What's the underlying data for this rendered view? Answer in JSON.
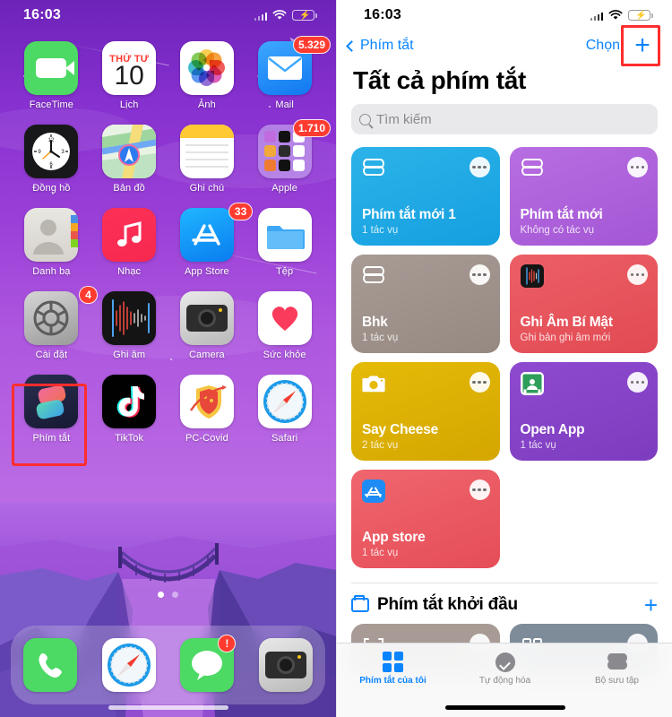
{
  "home": {
    "status": {
      "time": "16:03",
      "wifi": "wifi-icon",
      "battery": "battery-charging-icon",
      "signal": "cellular-signal-icon"
    },
    "apps": [
      {
        "label": "FaceTime",
        "icon": "facetime-icon",
        "badge": null
      },
      {
        "label": "Lịch",
        "icon": "calendar-icon",
        "badge": null,
        "cal_day": "THỨ TƯ",
        "cal_date": "10"
      },
      {
        "label": "Ảnh",
        "icon": "photos-icon",
        "badge": null
      },
      {
        "label": "Mail",
        "icon": "mail-icon",
        "badge": "5.329"
      },
      {
        "label": "Đồng hồ",
        "icon": "clock-icon",
        "badge": null
      },
      {
        "label": "Bản đồ",
        "icon": "maps-icon",
        "badge": null
      },
      {
        "label": "Ghi chú",
        "icon": "notes-icon",
        "badge": null
      },
      {
        "label": "Apple",
        "icon": "folder-icon",
        "badge": "1.710"
      },
      {
        "label": "Danh bạ",
        "icon": "contacts-icon",
        "badge": null
      },
      {
        "label": "Nhạc",
        "icon": "music-icon",
        "badge": null
      },
      {
        "label": "App Store",
        "icon": "appstore-icon",
        "badge": "33"
      },
      {
        "label": "Tệp",
        "icon": "files-icon",
        "badge": null
      },
      {
        "label": "Cài đặt",
        "icon": "settings-icon",
        "badge": "4"
      },
      {
        "label": "Ghi âm",
        "icon": "voice-memos-icon",
        "badge": null
      },
      {
        "label": "Camera",
        "icon": "camera-icon",
        "badge": null
      },
      {
        "label": "Sức khỏe",
        "icon": "health-icon",
        "badge": null
      },
      {
        "label": "Phím tắt",
        "icon": "shortcuts-icon",
        "badge": null,
        "highlighted": true
      },
      {
        "label": "TikTok",
        "icon": "tiktok-icon",
        "badge": null
      },
      {
        "label": "PC-Covid",
        "icon": "pccovid-icon",
        "badge": null
      },
      {
        "label": "Safari",
        "icon": "safari-icon",
        "badge": null
      }
    ],
    "page_dots": {
      "count": 2,
      "active_index": 0
    },
    "dock": [
      {
        "label": "Phone",
        "icon": "phone-icon",
        "badge": null
      },
      {
        "label": "Safari",
        "icon": "safari-icon",
        "badge": null
      },
      {
        "label": "Messages",
        "icon": "messages-icon",
        "badge": "!"
      },
      {
        "label": "Camera",
        "icon": "camera-icon",
        "badge": null
      }
    ]
  },
  "shortcuts": {
    "status": {
      "time": "16:03",
      "wifi": "wifi-icon",
      "battery": "battery-charging-icon",
      "signal": "cellular-signal-icon"
    },
    "nav": {
      "back_label": "Phím tắt",
      "back_icon": "chevron-left-icon",
      "select_label": "Chọn",
      "add_icon": "plus-icon",
      "add_highlighted": true
    },
    "title": "Tất cả phím tắt",
    "search": {
      "placeholder": "Tìm kiếm",
      "icon": "search-icon",
      "value": ""
    },
    "cards": [
      {
        "name": "Phím tắt mới 1",
        "subtitle": "1 tác vụ",
        "color": "#26ace4",
        "color2": "#1aa7e8",
        "icon": "layers-icon",
        "menu": "more-icon"
      },
      {
        "name": "Phím tắt mới",
        "subtitle": "Không có tác vụ",
        "color": "#b367de",
        "color2": "#a95fd8",
        "icon": "layers-icon",
        "menu": "more-icon"
      },
      {
        "name": "Bhk",
        "subtitle": "1 tác vụ",
        "color": "#a2958f",
        "color2": "#9a8d86",
        "icon": "layers-icon",
        "menu": "more-icon"
      },
      {
        "name": "Ghi Âm Bí Mật",
        "subtitle": "Ghi bản ghi âm mới",
        "color": "#e8555d",
        "color2": "#e44d55",
        "icon": "voice-memos-icon",
        "menu": "more-icon"
      },
      {
        "name": "Say Cheese",
        "subtitle": "2 tác vụ",
        "color": "#e0b400",
        "color2": "#d8ad00",
        "icon": "camera-icon",
        "menu": "more-icon"
      },
      {
        "name": "Open App",
        "subtitle": "1 tác vụ",
        "color": "#8644c8",
        "color2": "#7e3dc0",
        "icon": "classroom-icon",
        "menu": "more-icon"
      },
      {
        "name": "App store",
        "subtitle": "1 tác vụ",
        "color": "#ed5a63",
        "color2": "#e8535c",
        "icon": "appstore-icon",
        "menu": "more-icon"
      }
    ],
    "section": {
      "folder_icon": "folder-icon",
      "title": "Phím tắt khởi đầu",
      "add_icon": "plus-icon"
    },
    "peek_cards": [
      {
        "color": "#a2958f",
        "icon": "scan-icon",
        "menu": "more-icon"
      },
      {
        "color": "#7e8b99",
        "icon": "qr-icon",
        "menu": "more-icon"
      }
    ],
    "tabs": [
      {
        "label": "Phím tắt của tôi",
        "icon": "grid-icon",
        "active": true
      },
      {
        "label": "Tự động hóa",
        "icon": "clock-check-icon",
        "active": false
      },
      {
        "label": "Bộ sưu tập",
        "icon": "layers-icon",
        "active": false
      }
    ]
  },
  "theme": {
    "accent": "#0a84ff",
    "highlight": "#ff2d2d",
    "badge": "#ff3b30"
  }
}
